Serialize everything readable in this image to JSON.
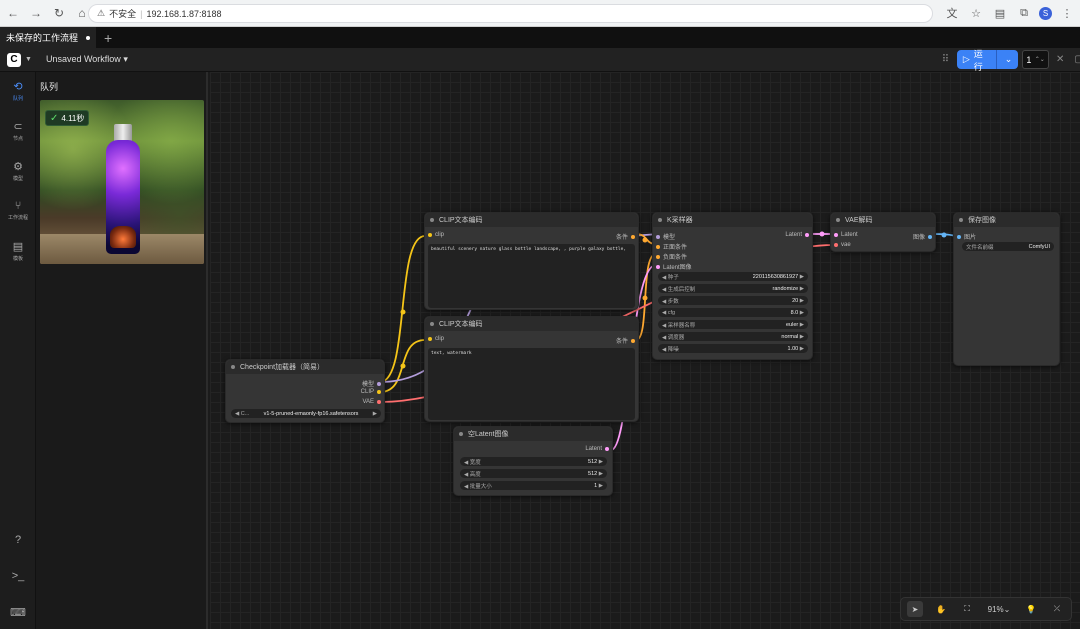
{
  "browser": {
    "security_label": "不安全",
    "url": "192.168.1.87:8188"
  },
  "tabs": [
    {
      "label": "未保存的工作流程"
    }
  ],
  "menu": {
    "workflow_title": "Unsaved Workflow",
    "run_label": "运行",
    "batch_count": "1"
  },
  "sidebar": {
    "items": [
      {
        "label": "队列",
        "icon": "history-icon"
      },
      {
        "label": "节点",
        "icon": "node-library-icon"
      },
      {
        "label": "模型",
        "icon": "model-library-icon"
      },
      {
        "label": "工作流程",
        "icon": "workflows-icon"
      },
      {
        "label": "模板",
        "icon": "templates-icon"
      }
    ]
  },
  "queue": {
    "title": "队列",
    "badge_time": "4.11秒"
  },
  "nodes": {
    "clip_pos": {
      "title": "CLIP文本编码",
      "in_clip": "clip",
      "out_cond": "条件",
      "text": "beautiful scenery nature glass bottle landscape, , purple galaxy bottle,"
    },
    "clip_neg": {
      "title": "CLIP文本编码",
      "in_clip": "clip",
      "out_cond": "条件",
      "text": "text, watermark"
    },
    "checkpoint": {
      "title": "Checkpoint加载器（简易）",
      "out_model": "模型",
      "out_clip": "CLIP",
      "out_vae": "VAE",
      "ckpt_prefix": "C...",
      "ckpt_name": "v1-5-pruned-emaonly-fp16.safetensors"
    },
    "ksampler": {
      "title": "K采样器",
      "in_model": "模型",
      "in_pos": "正面条件",
      "in_neg": "负面条件",
      "in_latent": "Latent图像",
      "out_latent": "Latent",
      "widgets": [
        {
          "label": "种子",
          "value": "220115630861927"
        },
        {
          "label": "生成后控制",
          "value": "randomize"
        },
        {
          "label": "步数",
          "value": "20"
        },
        {
          "label": "cfg",
          "value": "8.0"
        },
        {
          "label": "采样器名称",
          "value": "euler"
        },
        {
          "label": "调度器",
          "value": "normal"
        },
        {
          "label": "降噪",
          "value": "1.00"
        }
      ]
    },
    "vae_decode": {
      "title": "VAE解码",
      "in_latent": "Latent",
      "in_vae": "vae",
      "out_image": "图像"
    },
    "save_image": {
      "title": "保存图像",
      "in_image": "图片",
      "prefix_label": "文件名前缀",
      "prefix_value": "ComfyUI"
    },
    "empty_latent": {
      "title": "空Latent图像",
      "out_latent": "Latent",
      "widgets": [
        {
          "label": "宽度",
          "value": "512"
        },
        {
          "label": "高度",
          "value": "512"
        },
        {
          "label": "批量大小",
          "value": "1"
        }
      ]
    }
  },
  "toolbar": {
    "zoom": "91%"
  },
  "colors": {
    "accent": "#3b82f6",
    "clip_wire": "#f5c518",
    "cond_wire": "#ffa931",
    "latent_wire": "#ff9cf9",
    "vae_wire": "#ff6e6e",
    "image_wire": "#64b5f6",
    "model_wire": "#b39ddb"
  }
}
